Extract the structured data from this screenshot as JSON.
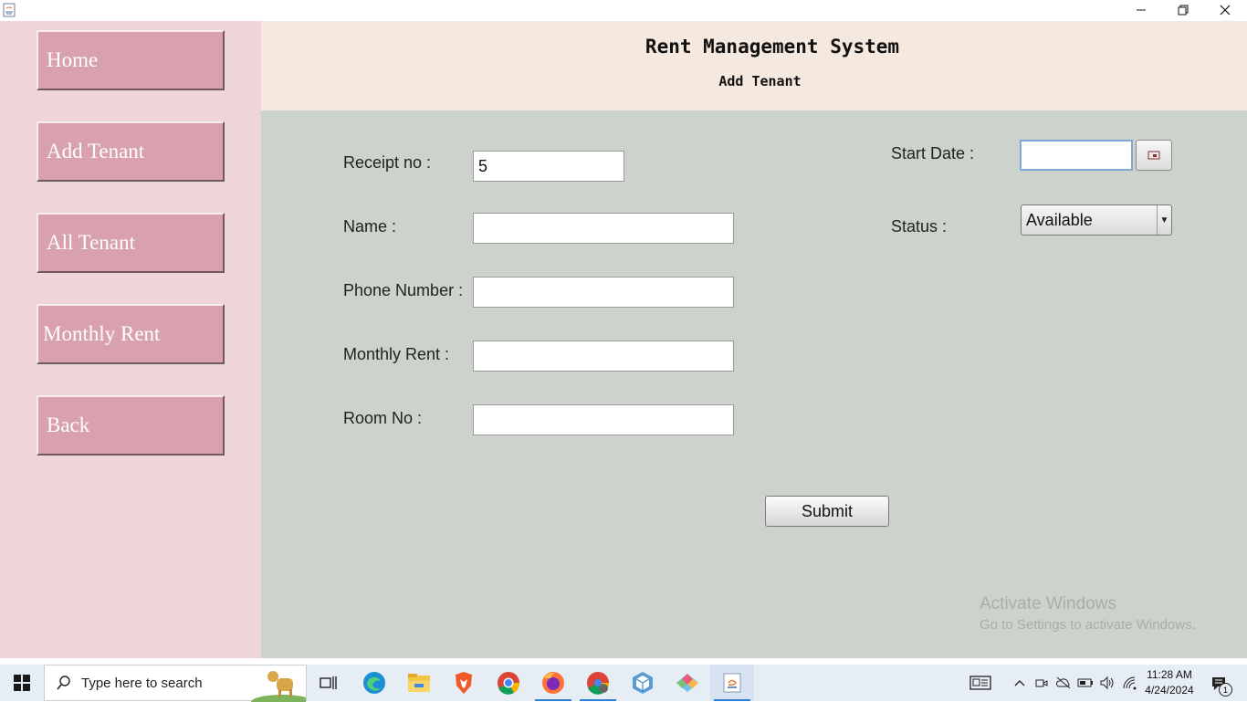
{
  "window": {
    "controls": [
      "minimize",
      "restore",
      "close"
    ]
  },
  "sidebar": {
    "items": [
      {
        "label": "Home"
      },
      {
        "label": "Add Tenant"
      },
      {
        "label": "All Tenant"
      },
      {
        "label": "Monthly Rent"
      },
      {
        "label": "Back"
      }
    ]
  },
  "header": {
    "title": "Rent Management System",
    "subtitle": "Add Tenant"
  },
  "form": {
    "receipt_label": "Receipt no :",
    "receipt_value": "5",
    "name_label": "Name :",
    "name_value": "",
    "phone_label": "Phone Number :",
    "phone_value": "",
    "rent_label": "Monthly Rent :",
    "rent_value": "",
    "room_label": "Room No :",
    "room_value": "",
    "start_date_label": "Start Date :",
    "start_date_value": "",
    "status_label": "Status :",
    "status_value": "Available",
    "submit_label": "Submit"
  },
  "watermark": {
    "line1": "Activate Windows",
    "line2": "Go to Settings to activate Windows."
  },
  "taskbar": {
    "search_placeholder": "Type here to search",
    "time": "11:28 AM",
    "date": "4/24/2024",
    "notification_count": "1"
  },
  "colors": {
    "sidebar_bg": "#efd4d9",
    "sidebar_button": "#d8a1ad",
    "header_bg": "#f5e8de",
    "form_bg": "#cbd3cb"
  }
}
